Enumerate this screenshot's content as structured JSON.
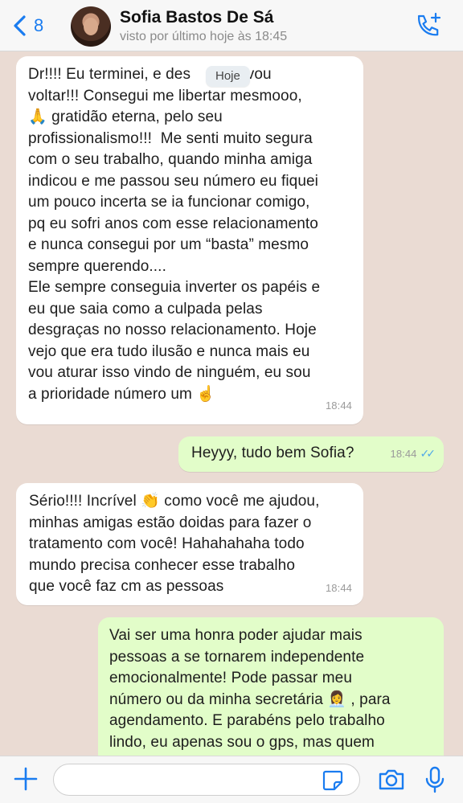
{
  "header": {
    "back_count": "8",
    "contact_name": "Sofia Bastos De Sá",
    "last_seen": "visto por último hoje às 18:45"
  },
  "date_separator": "Hoje",
  "messages": [
    {
      "direction": "incoming",
      "text": "Dr!!!! Eu terminei, e des      não vou\nvoltar!!! Consegui me libertar mesmooo,\n🙏 gratidão eterna, pelo seu\nprofissionalismo!!!  Me senti muito segura\ncom o seu trabalho, quando minha amiga\nindicou e me passou seu número eu fiquei\num pouco incerta se ia funcionar comigo,\npq eu sofri anos com esse relacionamento\ne nunca consegui por um “basta” mesmo\nsempre querendo....\nEle sempre conseguia inverter os papéis e\neu que saia como a culpada pelas\ndesgraças no nosso relacionamento. Hoje\nvejo que era tudo ilusão e nunca mais eu\nvou aturar isso vindo de ninguém, eu sou\na prioridade número um ☝️",
      "time": "18:44"
    },
    {
      "direction": "outgoing",
      "text": "Heyyy, tudo bem Sofia?",
      "time": "18:44",
      "read_ticks": "✓✓"
    },
    {
      "direction": "incoming",
      "text": "Sério!!!! Incrível 👏 como você me ajudou,\nminhas amigas estão doidas para fazer o\ntratamento com você! Hahahahaha todo\nmundo precisa conhecer esse trabalho\nque você faz cm as pessoas",
      "time": "18:44"
    },
    {
      "direction": "outgoing",
      "text": "Vai ser uma honra poder ajudar mais\npessoas a se tornarem independente\nemocionalmente! Pode passar meu\nnúmero ou da minha secretária 👩‍💼 , para\nagendamento. E parabéns pelo trabalho\nlindo, eu apenas sou o gps, mas quem",
      "time": ""
    }
  ],
  "input_bar": {
    "placeholder": ""
  },
  "icons": {
    "back": "chevron-left-icon",
    "call": "phone-add-icon",
    "plus": "plus-icon",
    "sticker": "sticker-icon",
    "camera": "camera-icon",
    "mic": "microphone-icon"
  },
  "colors": {
    "accent": "#1a7cf0",
    "chat_background": "#eadbd3",
    "incoming_bubble": "#ffffff",
    "outgoing_bubble": "#e2fdc9",
    "read_ticks": "#4fa8e8"
  }
}
